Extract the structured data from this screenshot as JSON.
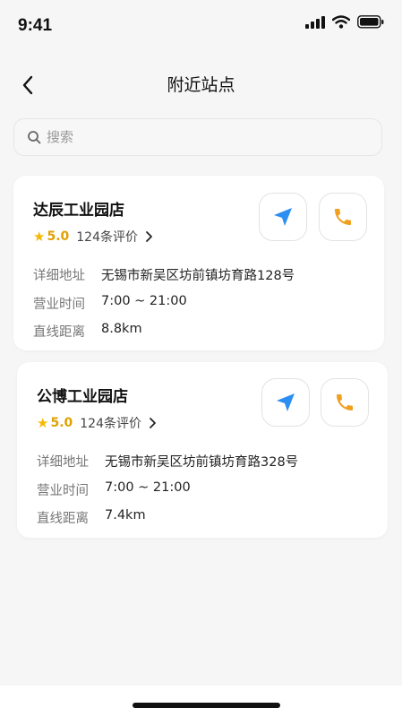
{
  "status_bar": {
    "time": "9:41"
  },
  "nav": {
    "title": "附近站点"
  },
  "search": {
    "placeholder": "搜索"
  },
  "stores": [
    {
      "name": "达辰工业园店",
      "rating": "5.0",
      "reviews": "124条评价",
      "address_label": "详细地址",
      "address": "无锡市新吴区坊前镇坊育路128号",
      "hours_label": "营业时间",
      "hours": "7:00 ~ 21:00",
      "distance_label": "直线距离",
      "distance": "8.8km"
    },
    {
      "name": "公博工业园店",
      "rating": "5.0",
      "reviews": "124条评价",
      "address_label": "详细地址",
      "address": "无锡市新吴区坊前镇坊育路328号",
      "hours_label": "营业时间",
      "hours": "7:00 ~ 21:00",
      "distance_label": "直线距离",
      "distance": "7.4km"
    }
  ],
  "icons": {
    "navigate": "navigation-arrow-icon",
    "call": "phone-icon",
    "star": "star-icon"
  },
  "colors": {
    "navigate_blue": "#2b8ef0",
    "phone_orange": "#f0a020",
    "star_yellow": "#f6b800"
  }
}
